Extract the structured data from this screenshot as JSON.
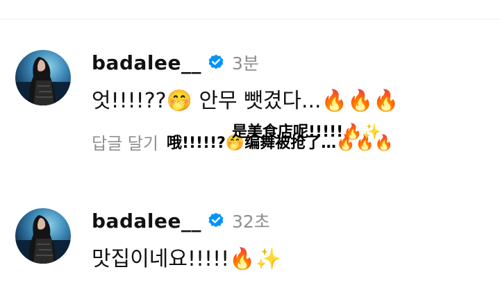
{
  "comments": [
    {
      "username": "badalee__",
      "time": "3분",
      "text": "엇!!!!??🤭 안무 뺏겼다...🔥🔥🔥",
      "reply_label": "답글 달기",
      "subtitles": [
        "哦!!!!!?🤭编舞被抢了…🔥🔥🔥",
        "是美食店呢!!!!!🔥✨"
      ]
    },
    {
      "username": "badalee__",
      "time": "32초",
      "text": "맛집이네요!!!!!🔥✨"
    }
  ],
  "colors": {
    "verified_badge": "#0095f6",
    "muted_text": "#8e8e8e",
    "username": "#111111"
  },
  "icons": {
    "verified": "verified-badge-icon",
    "avatar": "profile-photo"
  }
}
